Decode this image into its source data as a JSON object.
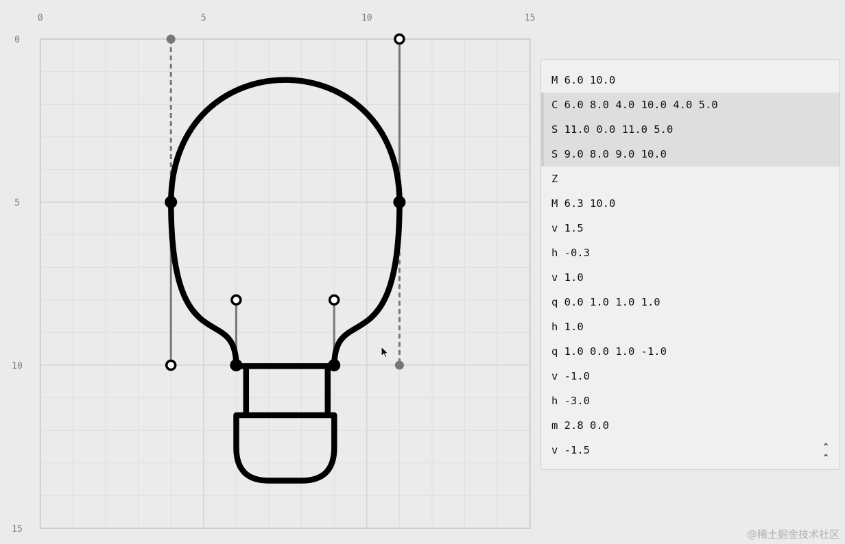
{
  "canvas": {
    "axis_ticks": [
      "0",
      "5",
      "10",
      "15"
    ],
    "guides": [
      {
        "kind": "dashed",
        "from": [
          4,
          0
        ],
        "to": [
          4,
          5
        ]
      },
      {
        "kind": "solid",
        "from": [
          4,
          5
        ],
        "to": [
          4,
          10
        ]
      },
      {
        "kind": "solid",
        "from": [
          11,
          0
        ],
        "to": [
          11,
          5
        ]
      },
      {
        "kind": "dashed",
        "from": [
          11,
          5
        ],
        "to": [
          11,
          10
        ]
      },
      {
        "kind": "solid",
        "from": [
          6,
          8
        ],
        "to": [
          6,
          10
        ]
      },
      {
        "kind": "solid",
        "from": [
          9,
          8
        ],
        "to": [
          9,
          10
        ]
      }
    ],
    "control_points": [
      {
        "name": "reflected-control-point",
        "style": "gray",
        "at": [
          4,
          0
        ]
      },
      {
        "name": "control-point",
        "style": "open",
        "at": [
          11,
          0
        ]
      },
      {
        "name": "control-point",
        "style": "open",
        "at": [
          4,
          10
        ]
      },
      {
        "name": "reflected-control-point",
        "style": "gray",
        "at": [
          11,
          10
        ]
      },
      {
        "name": "control-point",
        "style": "open",
        "at": [
          6,
          8
        ]
      },
      {
        "name": "control-point",
        "style": "open",
        "at": [
          9,
          8
        ]
      },
      {
        "name": "anchor-point",
        "style": "solid",
        "at": [
          4,
          5
        ]
      },
      {
        "name": "anchor-point",
        "style": "solid",
        "at": [
          11,
          5
        ]
      },
      {
        "name": "anchor-point",
        "style": "solid",
        "at": [
          6,
          10
        ]
      },
      {
        "name": "anchor-point",
        "style": "solid",
        "at": [
          9,
          10
        ]
      }
    ]
  },
  "path_commands": [
    {
      "text": "M 6.0 10.0",
      "selected": false
    },
    {
      "text": "C 6.0 8.0 4.0 10.0 4.0 5.0",
      "selected": true
    },
    {
      "text": "S 11.0 0.0 11.0 5.0",
      "selected": true
    },
    {
      "text": "S 9.0 8.0 9.0 10.0",
      "selected": true
    },
    {
      "text": "Z",
      "selected": false
    },
    {
      "text": "M 6.3 10.0",
      "selected": false
    },
    {
      "text": "v 1.5",
      "selected": false
    },
    {
      "text": "h -0.3",
      "selected": false
    },
    {
      "text": "v 1.0",
      "selected": false
    },
    {
      "text": "q 0.0 1.0 1.0 1.0",
      "selected": false
    },
    {
      "text": "h 1.0",
      "selected": false
    },
    {
      "text": "q 1.0 0.0 1.0 -1.0",
      "selected": false
    },
    {
      "text": "v -1.0",
      "selected": false
    },
    {
      "text": "h -3.0",
      "selected": false
    },
    {
      "text": "m 2.8 0.0",
      "selected": false
    },
    {
      "text": "v -1.5",
      "selected": false
    }
  ],
  "scroll_top_icon": "double-chevron-up-icon",
  "scroll_top_glyph": "⌃",
  "watermark": "@稀土掘金技术社区",
  "colors": {
    "path_stroke": "#000000",
    "guide": "#777777",
    "grid_minor": "#dedede",
    "grid_major": "#d4d4d4",
    "canvas_bg": "#ebebeb",
    "panel_selected": "#dedede"
  }
}
